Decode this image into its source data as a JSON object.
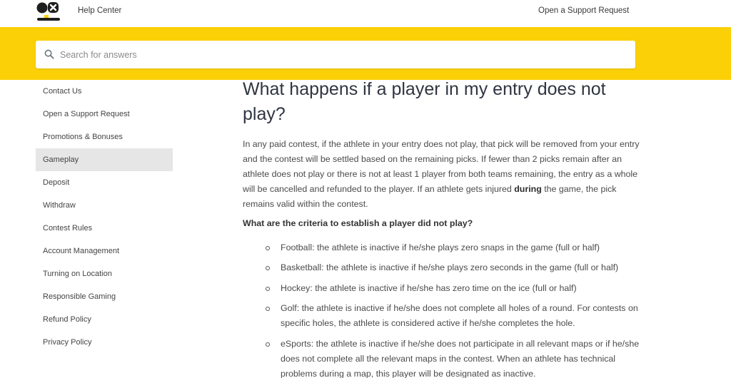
{
  "header": {
    "help_center": "Help Center",
    "support_link": "Open a Support Request"
  },
  "search": {
    "placeholder": "Search for answers"
  },
  "colors": {
    "brand_yellow": "#fbd006",
    "active_sidebar_bg": "#e6e6e6",
    "title_color": "#2f3542"
  },
  "sidebar": {
    "items": [
      {
        "label": "Contact Us"
      },
      {
        "label": "Open a Support Request"
      },
      {
        "label": "Promotions & Bonuses"
      },
      {
        "label": "Gameplay",
        "active": true
      },
      {
        "label": "Deposit"
      },
      {
        "label": "Withdraw"
      },
      {
        "label": "Contest Rules"
      },
      {
        "label": "Account Management"
      },
      {
        "label": "Turning on Location"
      },
      {
        "label": "Responsible Gaming"
      },
      {
        "label": "Refund Policy"
      },
      {
        "label": "Privacy Policy"
      }
    ]
  },
  "article": {
    "title": "What happens if a player in my entry does not play?",
    "intro_before": "In any paid contest, if the athlete in your entry does not play, that pick will be removed from your entry and the contest will be settled based on the remaining picks. If fewer than 2 picks remain after an athlete does not play or there is not at least 1 player from both teams remaining, the entry as a whole will be cancelled and refunded to the player. If an athlete gets injured ",
    "intro_bold": "during",
    "intro_after": " the game, the pick remains valid within the contest.",
    "question": "What are the criteria to establish a player did not play?",
    "criteria": [
      "Football: the athlete is inactive if he/she plays zero snaps in the game (full or half)",
      "Basketball: the athlete is inactive if he/she plays zero seconds in the game (full or half)",
      "Hockey: the athlete is inactive if he/she has zero time on the ice (full or half)",
      "Golf: the athlete is inactive if he/she does not complete all holes of a round. For contests on specific holes, the athlete is considered active if he/she completes the hole.",
      "eSports: the athlete is inactive if he/she does not participate in all relevant maps or if he/she does not complete all the relevant maps in the contest. When an athlete has technical problems during a map, this player will be designated as inactive."
    ]
  }
}
